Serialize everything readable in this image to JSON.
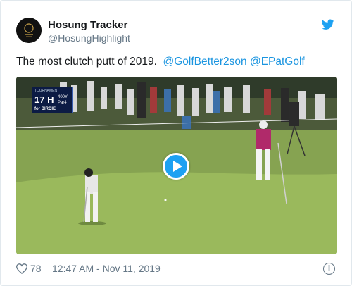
{
  "tweet": {
    "display_name": "Hosung Tracker",
    "handle": "@HosungHighlight",
    "text_prefix": "The most clutch putt of 2019.",
    "mentions": [
      "@GolfBetter2son",
      "@EPatGolf"
    ],
    "likes": "78",
    "timestamp": "12:47 AM - Nov 11, 2019"
  },
  "media": {
    "scorebug": {
      "header": "TOURNAMENT",
      "hole": "17 H",
      "yardage": "400Y",
      "par": "Par4",
      "subtitle": "for BIRDIE"
    }
  },
  "icons": {
    "brand": "twitter-bird-icon",
    "like": "heart-icon",
    "info": "info-icon",
    "play": "play-icon"
  },
  "colors": {
    "accent": "#1da1f2",
    "mention": "#1b95e0",
    "muted": "#657786"
  }
}
